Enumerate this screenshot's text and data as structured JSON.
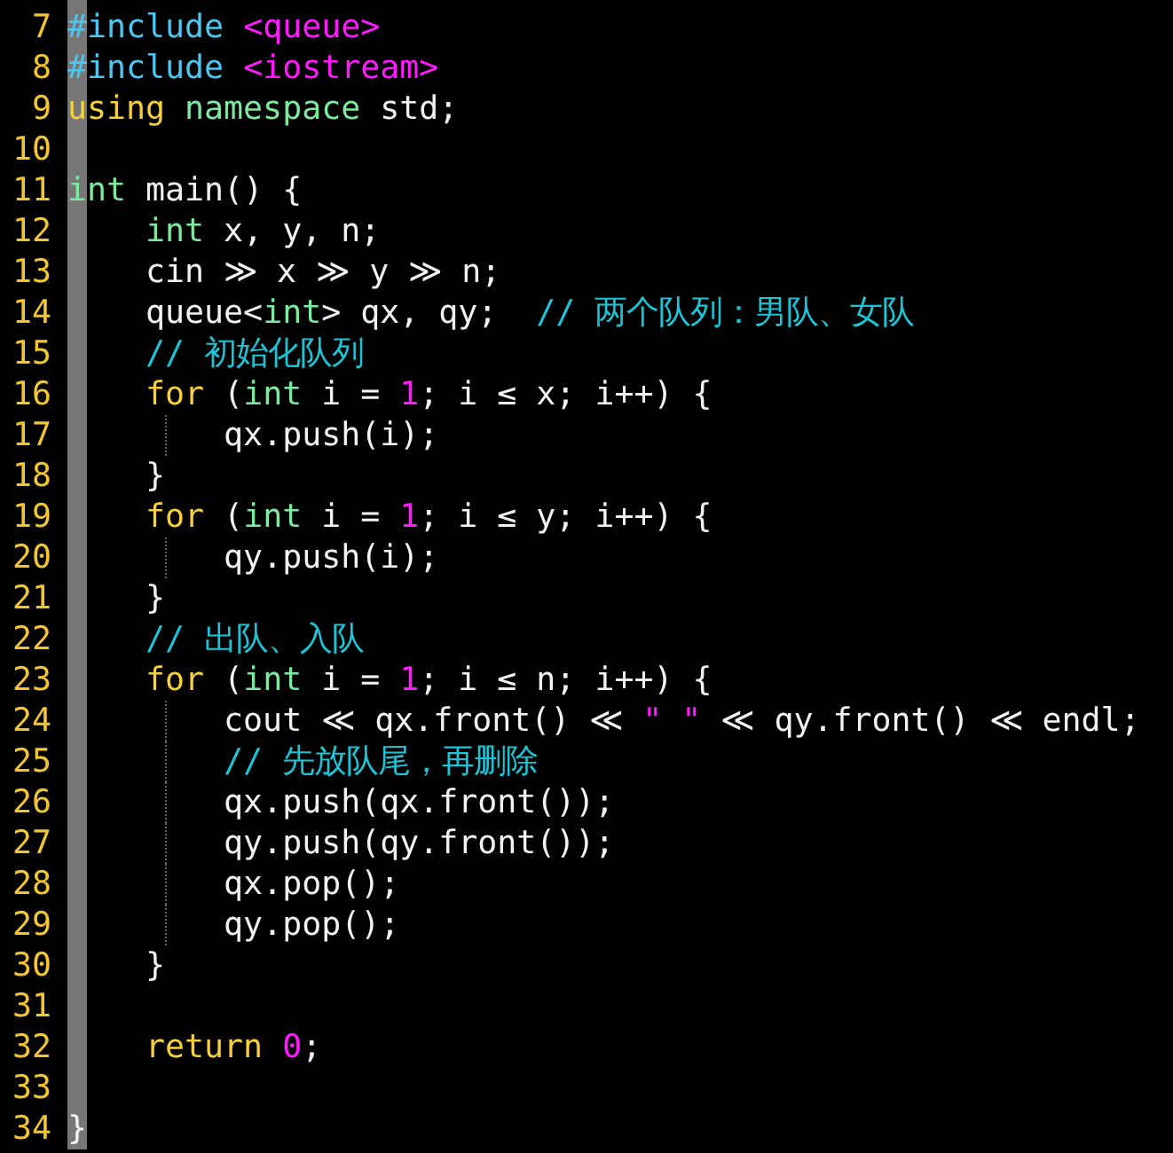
{
  "editor": {
    "lines": [
      {
        "number": "7",
        "tokens": [
          {
            "kind": "pre",
            "text": "#include"
          },
          {
            "kind": "lit",
            "text": " <queue>"
          }
        ]
      },
      {
        "number": "8",
        "tokens": [
          {
            "kind": "pre",
            "text": "#include"
          },
          {
            "kind": "lit",
            "text": " <iostream>"
          }
        ]
      },
      {
        "number": "9",
        "tokens": [
          {
            "kind": "kw",
            "text": "using"
          },
          {
            "kind": "type",
            "text": " namespace"
          },
          {
            "kind": "plain",
            "text": " std;"
          }
        ]
      },
      {
        "number": "10"
      },
      {
        "number": "11",
        "tokens": [
          {
            "kind": "type",
            "text": "int"
          },
          {
            "kind": "plain",
            "text": " main() {"
          }
        ]
      },
      {
        "number": "12",
        "tokens": [
          {
            "kind": "type",
            "text": "    int"
          },
          {
            "kind": "plain",
            "text": " x, y, n;"
          }
        ]
      },
      {
        "number": "13",
        "tokens": [
          {
            "kind": "plain",
            "text": "    cin ≫ x ≫ y ≫ n;"
          }
        ]
      },
      {
        "number": "14",
        "tokens": [
          {
            "kind": "plain",
            "text": "    queue<"
          },
          {
            "kind": "type",
            "text": "int"
          },
          {
            "kind": "plain",
            "text": "> qx, qy;"
          },
          {
            "kind": "cmt",
            "text": "  // 两个队列：男队、女队"
          }
        ]
      },
      {
        "number": "15",
        "tokens": [
          {
            "kind": "cmt",
            "text": "    // 初始化队列"
          }
        ]
      },
      {
        "number": "16",
        "tokens": [
          {
            "kind": "kw",
            "text": "    for"
          },
          {
            "kind": "plain",
            "text": " ("
          },
          {
            "kind": "type",
            "text": "int"
          },
          {
            "kind": "plain",
            "text": " i = "
          },
          {
            "kind": "lit",
            "text": "1"
          },
          {
            "kind": "plain",
            "text": "; i ≤ x; i++) {"
          }
        ]
      },
      {
        "number": "17",
        "guide": true,
        "tokens": [
          {
            "kind": "plain",
            "text": "        qx.push(i);"
          }
        ]
      },
      {
        "number": "18",
        "tokens": [
          {
            "kind": "plain",
            "text": "    }"
          }
        ]
      },
      {
        "number": "19",
        "tokens": [
          {
            "kind": "kw",
            "text": "    for"
          },
          {
            "kind": "plain",
            "text": " ("
          },
          {
            "kind": "type",
            "text": "int"
          },
          {
            "kind": "plain",
            "text": " i = "
          },
          {
            "kind": "lit",
            "text": "1"
          },
          {
            "kind": "plain",
            "text": "; i ≤ y; i++) {"
          }
        ]
      },
      {
        "number": "20",
        "guide": true,
        "tokens": [
          {
            "kind": "plain",
            "text": "        qy.push(i);"
          }
        ]
      },
      {
        "number": "21",
        "tokens": [
          {
            "kind": "plain",
            "text": "    }"
          }
        ]
      },
      {
        "number": "22",
        "tokens": [
          {
            "kind": "cmt",
            "text": "    // 出队、入队"
          }
        ]
      },
      {
        "number": "23",
        "tokens": [
          {
            "kind": "kw",
            "text": "    for"
          },
          {
            "kind": "plain",
            "text": " ("
          },
          {
            "kind": "type",
            "text": "int"
          },
          {
            "kind": "plain",
            "text": " i = "
          },
          {
            "kind": "lit",
            "text": "1"
          },
          {
            "kind": "plain",
            "text": "; i ≤ n; i++) {"
          }
        ]
      },
      {
        "number": "24",
        "guide": true,
        "tokens": [
          {
            "kind": "plain",
            "text": "        cout ≪ qx.front() ≪ "
          },
          {
            "kind": "lit",
            "text": "\" \""
          },
          {
            "kind": "plain",
            "text": " ≪ qy.front() ≪ endl;"
          }
        ]
      },
      {
        "number": "25",
        "guide": true,
        "tokens": [
          {
            "kind": "cmt",
            "text": "        // 先放队尾，再删除"
          }
        ]
      },
      {
        "number": "26",
        "guide": true,
        "tokens": [
          {
            "kind": "plain",
            "text": "        qx.push(qx.front());"
          }
        ]
      },
      {
        "number": "27",
        "guide": true,
        "tokens": [
          {
            "kind": "plain",
            "text": "        qy.push(qy.front());"
          }
        ]
      },
      {
        "number": "28",
        "guide": true,
        "tokens": [
          {
            "kind": "plain",
            "text": "        qx.pop();"
          }
        ]
      },
      {
        "number": "29",
        "guide": true,
        "tokens": [
          {
            "kind": "plain",
            "text": "        qy.pop();"
          }
        ]
      },
      {
        "number": "30",
        "tokens": [
          {
            "kind": "plain",
            "text": "    }"
          }
        ]
      },
      {
        "number": "31"
      },
      {
        "number": "32",
        "tokens": [
          {
            "kind": "kw",
            "text": "    return"
          },
          {
            "kind": "lit",
            "text": " 0"
          },
          {
            "kind": "plain",
            "text": ";"
          }
        ]
      },
      {
        "number": "33"
      },
      {
        "number": "34",
        "tokens": [
          {
            "kind": "plain",
            "text": "}"
          }
        ]
      }
    ]
  }
}
